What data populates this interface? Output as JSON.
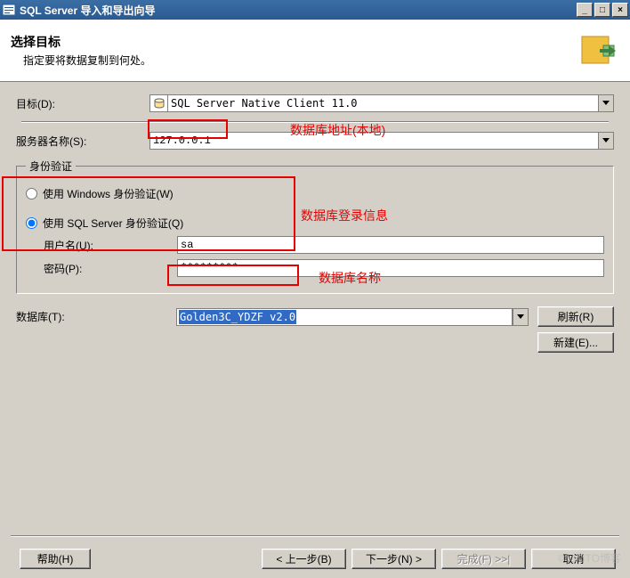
{
  "window": {
    "title": "SQL Server 导入和导出向导"
  },
  "header": {
    "title": "选择目标",
    "subtitle": "指定要将数据复制到何处。"
  },
  "fields": {
    "target_label": "目标(D):",
    "target_value": "SQL Server Native Client 11.0",
    "server_label": "服务器名称(S):",
    "server_value": "127.0.0.1"
  },
  "auth": {
    "legend": "身份验证",
    "windows_label": "使用 Windows 身份验证(W)",
    "sql_label": "使用 SQL Server 身份验证(Q)",
    "selected": "sql",
    "user_label": "用户名(U):",
    "user_value": "sa",
    "pass_label": "密码(P):",
    "pass_value": "*********"
  },
  "db": {
    "label": "数据库(T):",
    "value": "Golden3C_YDZF v2.0",
    "refresh": "刷新(R)",
    "new": "新建(E)..."
  },
  "buttons": {
    "help": "帮助(H)",
    "back": "< 上一步(B)",
    "next": "下一步(N) >",
    "finish": "完成(F) >>|",
    "cancel": "取消"
  },
  "annotations": {
    "addr": "数据库地址(本地)",
    "login": "数据库登录信息",
    "dbname": "数据库名称"
  },
  "watermark": "©51CTO博客"
}
